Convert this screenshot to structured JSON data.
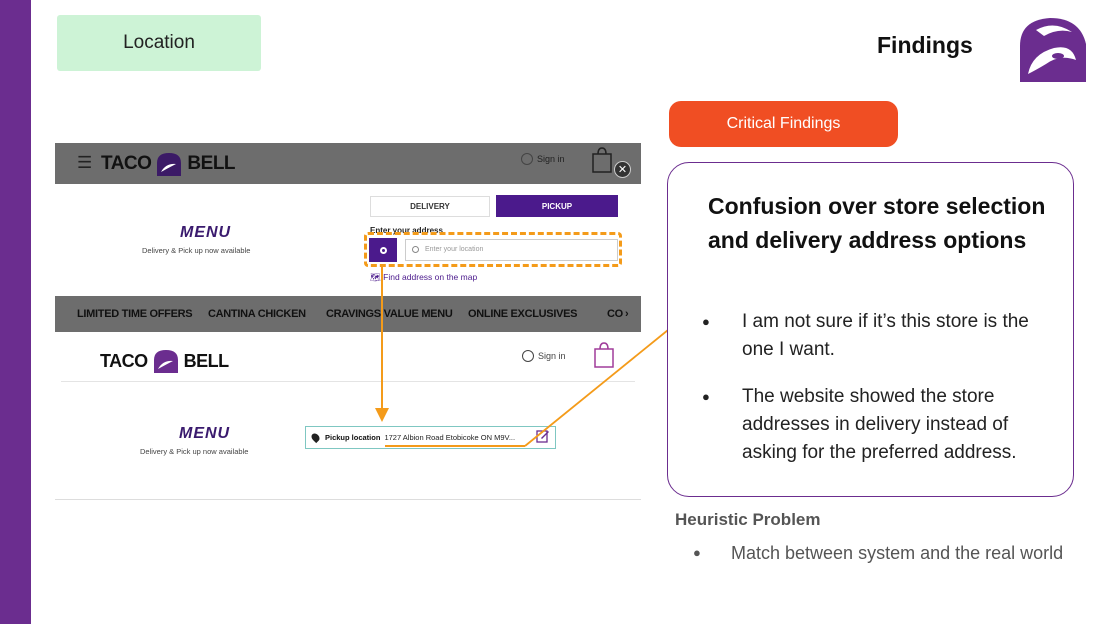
{
  "slide": {
    "location_tag": "Location",
    "title": "Findings",
    "critical_badge": "Critical Findings",
    "card": {
      "title": "Confusion over store selection and delivery address options",
      "bullets": [
        "I am not sure if it’s this store is the one I want.",
        "The website showed the store addresses in delivery instead of asking for the preferred address."
      ]
    },
    "heuristic": {
      "title": "Heuristic Problem",
      "items": [
        "Match between system and the real world"
      ]
    }
  },
  "screenshot": {
    "brand_left": "TACO",
    "brand_right": "BELL",
    "sign_in": "Sign in",
    "menu_logo": "MENU",
    "menu_sub": "Delivery & Pick up now available",
    "tab_delivery": "DELIVERY",
    "tab_pickup": "PICKUP",
    "enter_label": "Enter your address",
    "input_placeholder": "Enter your location",
    "find_map": "Find address on the map",
    "nav": [
      "LIMITED TIME OFFERS",
      "CANTINA CHICKEN",
      "CRAVINGS VALUE MENU",
      "ONLINE EXCLUSIVES",
      "CO"
    ],
    "pickup_label": "Pickup location",
    "pickup_address": "1727 Albion Road Etobicoke ON M9V..."
  },
  "colors": {
    "brand_purple": "#6b2d8f",
    "accent_orange": "#f49b1a",
    "critical_red": "#f04e23",
    "location_green": "#cdf3d6"
  }
}
